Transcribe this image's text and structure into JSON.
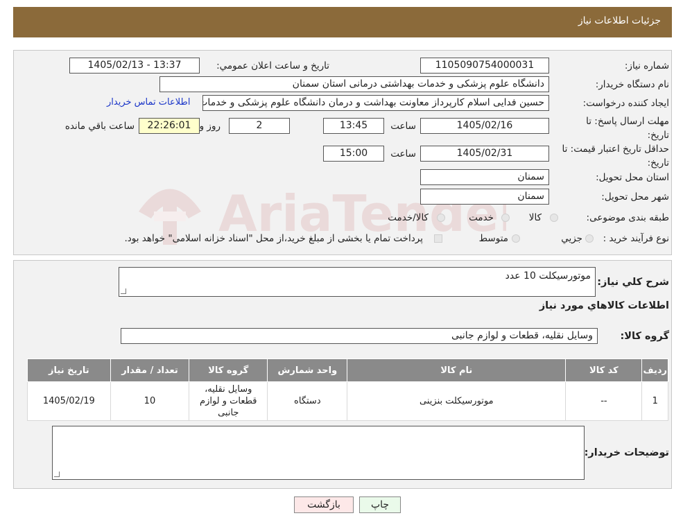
{
  "header": {
    "title": "جزئيات اطلاعات نياز"
  },
  "watermark": {
    "text": "AriaTender.neT"
  },
  "fields": {
    "need_number_label": "شماره نياز:",
    "need_number": "1105090754000031",
    "announce_label": "تاريخ و ساعت اعلان عمومي:",
    "announce_value": "1405/02/13 - 13:37",
    "buyer_org_label": "نام دستگاه خريدار:",
    "buyer_org": "دانشگاه علوم پزشکی و خدمات بهداشتی  درمانی استان سمنان",
    "creator_label": "ايجاد کننده درخواست:",
    "creator": "حسين فدايی اسلام کارپرداز معاونت بهداشت و درمان دانشگاه علوم پزشکی و خدمات بهداشتی",
    "contact_link": "اطلاعات تماس خريدار",
    "send_deadline_label": "مهلت ارسال پاسخ: تا تاريخ:",
    "send_date": "1405/02/16",
    "time_label": "ساعت",
    "send_time": "13:45",
    "days_value": "2",
    "days_label": "روز و",
    "remaining_value": "22:26:01",
    "remaining_label": "ساعت باقي مانده",
    "validity_label": "حداقل تاريخ اعتبار قيمت: تا تاريخ:",
    "validity_date": "1405/02/31",
    "validity_time": "15:00",
    "province_label": "استان محل تحويل:",
    "province": "سمنان",
    "city_label": "شهر محل تحويل:",
    "city": "سمنان",
    "category_label": "طبقه بندی موضوعی:",
    "category_options": [
      "کالا",
      "خدمت",
      "کالا/خدمت"
    ],
    "process_label": "نوع فرآيند خريد :",
    "process_options": [
      "جزيي",
      "متوسط"
    ],
    "payment_note": "پرداخت تمام يا بخشی از مبلغ خريد،از محل \"اسناد خزانه اسلامی\" خواهد بود."
  },
  "summary": {
    "label": "شرح کلي نياز:",
    "value": "موتورسيکلت 10 عدد",
    "goods_title": "اطلاعات کالاهاي مورد نياز",
    "group_label": "گروه کالا:",
    "group_value": "وسايل نقليه، قطعات و لوازم جانبی"
  },
  "table": {
    "headers": [
      "رديف",
      "کد کالا",
      "نام کالا",
      "واحد شمارش",
      "گروه کالا",
      "تعداد / مقدار",
      "تاريخ نياز"
    ],
    "rows": [
      [
        "1",
        "--",
        "موتورسيکلت بنزينی",
        "دستگاه",
        "وسايل نقليه، قطعات و لوازم جانبی",
        "10",
        "1405/02/19"
      ]
    ]
  },
  "buyer_notes": {
    "label": "توضيحات خريدار:",
    "value": ""
  },
  "buttons": {
    "print": "چاپ",
    "back": "بازگشت"
  }
}
